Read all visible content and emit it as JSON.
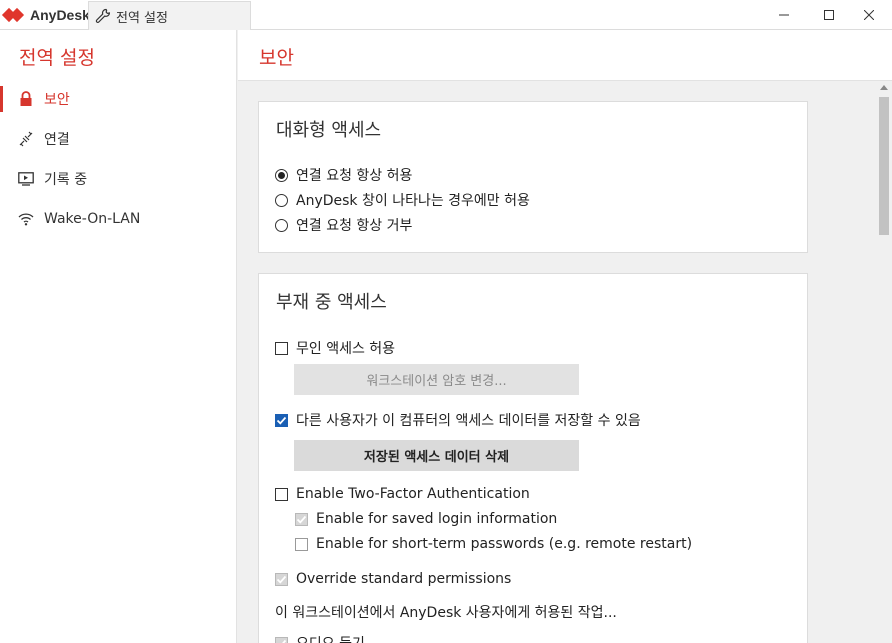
{
  "app": {
    "brand": "AnyDesk",
    "tab_title": "전역 설정",
    "colors": {
      "accent": "#d6362d",
      "checkbox_blue": "#1a5fb4"
    }
  },
  "window_controls": {
    "minimize": "minimize-icon",
    "maximize": "maximize-icon",
    "close": "close-icon"
  },
  "sidebar": {
    "title": "전역 설정",
    "items": [
      {
        "label": "보안",
        "icon": "lock-icon",
        "active": true
      },
      {
        "label": "연결",
        "icon": "connection-icon",
        "active": false
      },
      {
        "label": "기록 중",
        "icon": "recording-icon",
        "active": false
      },
      {
        "label": "Wake-On-LAN",
        "icon": "wifi-icon",
        "active": false
      }
    ]
  },
  "main": {
    "title": "보안",
    "interactive_access": {
      "title": "대화형 액세스",
      "options": [
        {
          "label": "연결 요청 항상 허용",
          "selected": true
        },
        {
          "label": "AnyDesk 창이 나타나는 경우에만 허용",
          "selected": false
        },
        {
          "label": "연결 요청 항상 거부",
          "selected": false
        }
      ]
    },
    "unattended_access": {
      "title": "부재 중 액세스",
      "allow_unattended": {
        "label": "무인 액세스 허용",
        "checked": false
      },
      "change_password_button": "워크스테이션 암호 변경...",
      "allow_save_data": {
        "label": "다른 사용자가 이 컴퓨터의 액세스 데이터를 저장할 수 있음",
        "checked": true
      },
      "delete_data_button": "저장된 액세스 데이터 삭제",
      "two_factor": {
        "label": "Enable Two-Factor Authentication",
        "checked": false
      },
      "saved_login": {
        "label": "Enable for saved login information",
        "checked": true
      },
      "short_term": {
        "label": "Enable for short-term passwords (e.g. remote restart)",
        "checked": false
      },
      "override": {
        "label": "Override standard permissions",
        "checked": true
      },
      "permissions_label": "이 워크스테이션에서 AnyDesk 사용자에게 허용된 작업...",
      "audio": {
        "label": "오디오 듣기",
        "checked": true
      }
    }
  }
}
